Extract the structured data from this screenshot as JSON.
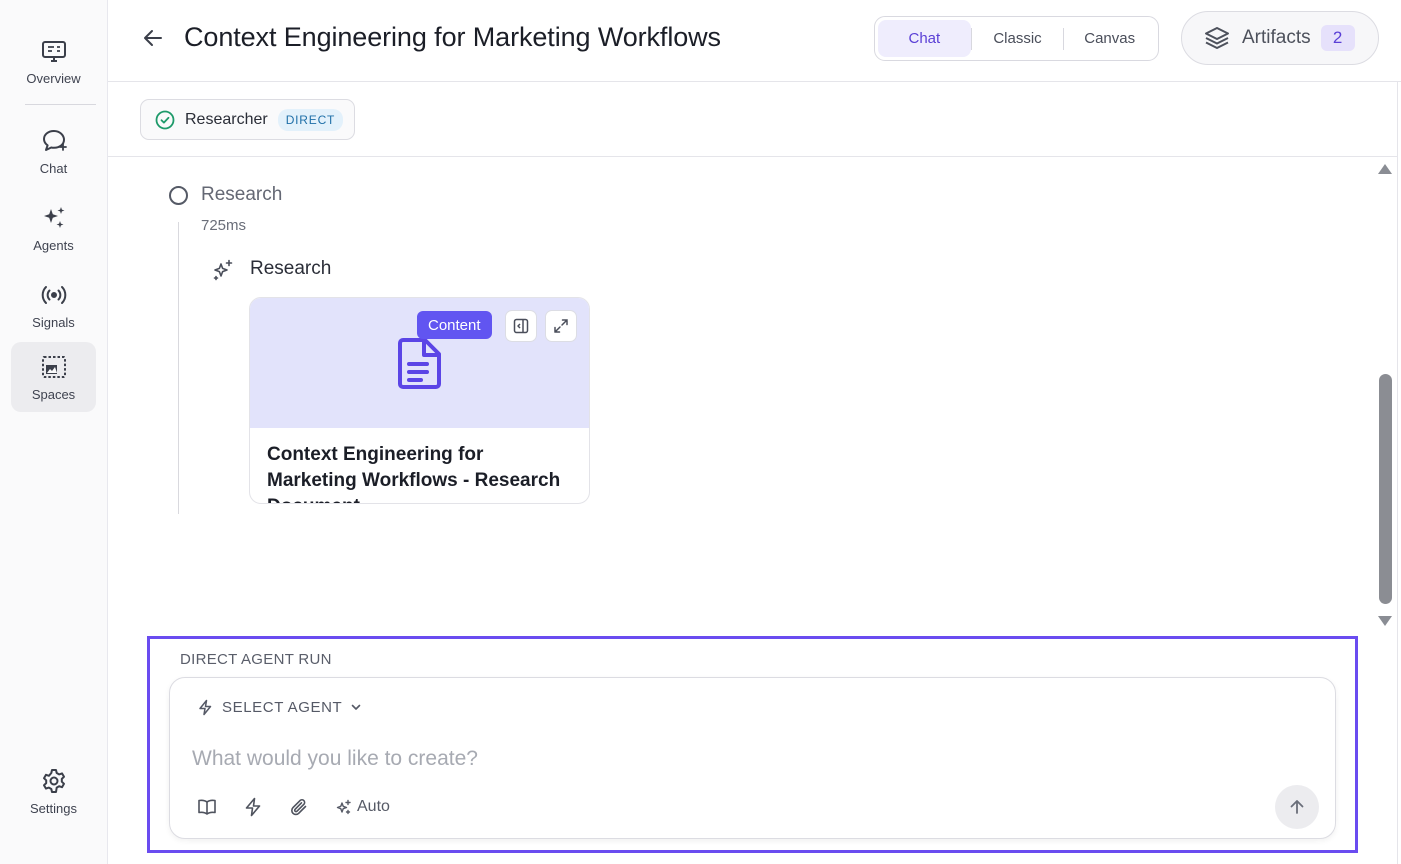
{
  "nav": {
    "items": [
      {
        "label": "Overview",
        "icon": "monitor-icon"
      },
      {
        "label": "Chat",
        "icon": "chat-bubble-icon"
      },
      {
        "label": "Agents",
        "icon": "sparkles-icon"
      },
      {
        "label": "Signals",
        "icon": "broadcast-icon"
      },
      {
        "label": "Spaces",
        "icon": "spaces-icon",
        "active": true
      }
    ],
    "settings_label": "Settings"
  },
  "header": {
    "title": "Context Engineering for Marketing Workflows",
    "views": [
      "Chat",
      "Classic",
      "Canvas"
    ],
    "active_view": "Chat",
    "artifacts_label": "Artifacts",
    "artifacts_count": "2"
  },
  "agent_chip": {
    "name": "Researcher",
    "badge": "DIRECT",
    "status": "completed"
  },
  "run": {
    "step_title": "Research",
    "step_duration": "725ms",
    "substep_title": "Research",
    "card": {
      "tag": "Content",
      "title": "Context Engineering for Marketing Workflows - Research Document"
    }
  },
  "composer": {
    "section_label": "DIRECT AGENT RUN",
    "select_agent_label": "SELECT AGENT",
    "placeholder": "What would you like to create?",
    "value": "",
    "auto_label": "Auto"
  },
  "colors": {
    "accent": "#6a4cf0",
    "tag": "#6155f1",
    "card_thumb": "#e2e3fb",
    "success": "#1e9a6a",
    "badge_text": "#1f6fa8"
  }
}
